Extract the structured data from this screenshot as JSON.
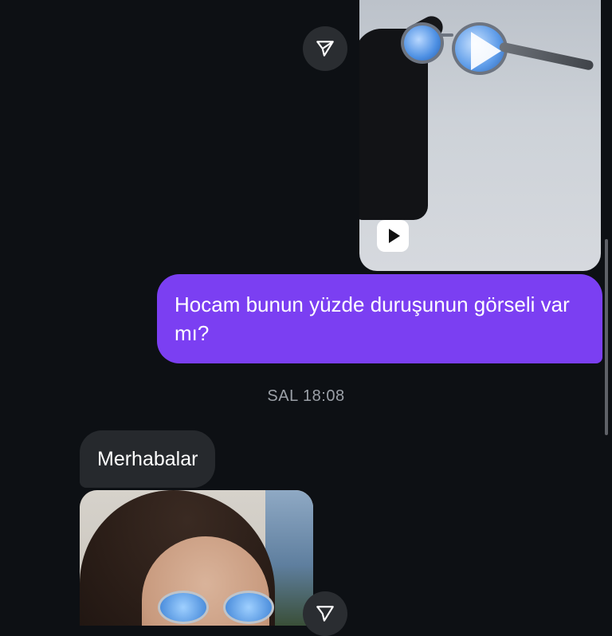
{
  "conversation": {
    "messages": [
      {
        "type": "video",
        "direction": "outgoing",
        "media_label": "Video with sunglasses held in gloved hand"
      },
      {
        "type": "text",
        "direction": "outgoing",
        "text": "Hocam bunun yüzde duruşunun görseli var mı?"
      },
      {
        "type": "timestamp",
        "text": "SAL 18:08"
      },
      {
        "type": "text",
        "direction": "incoming",
        "text": "Merhabalar"
      },
      {
        "type": "photo",
        "direction": "incoming"
      }
    ]
  },
  "icons": {
    "share": "send-arrow-icon",
    "video": "video-play-icon",
    "play": "play-icon"
  },
  "colors": {
    "background": "#0d1014",
    "outgoing_bubble": "#7b3ff2",
    "incoming_bubble": "#26292d",
    "timestamp": "#9ba0a7"
  }
}
